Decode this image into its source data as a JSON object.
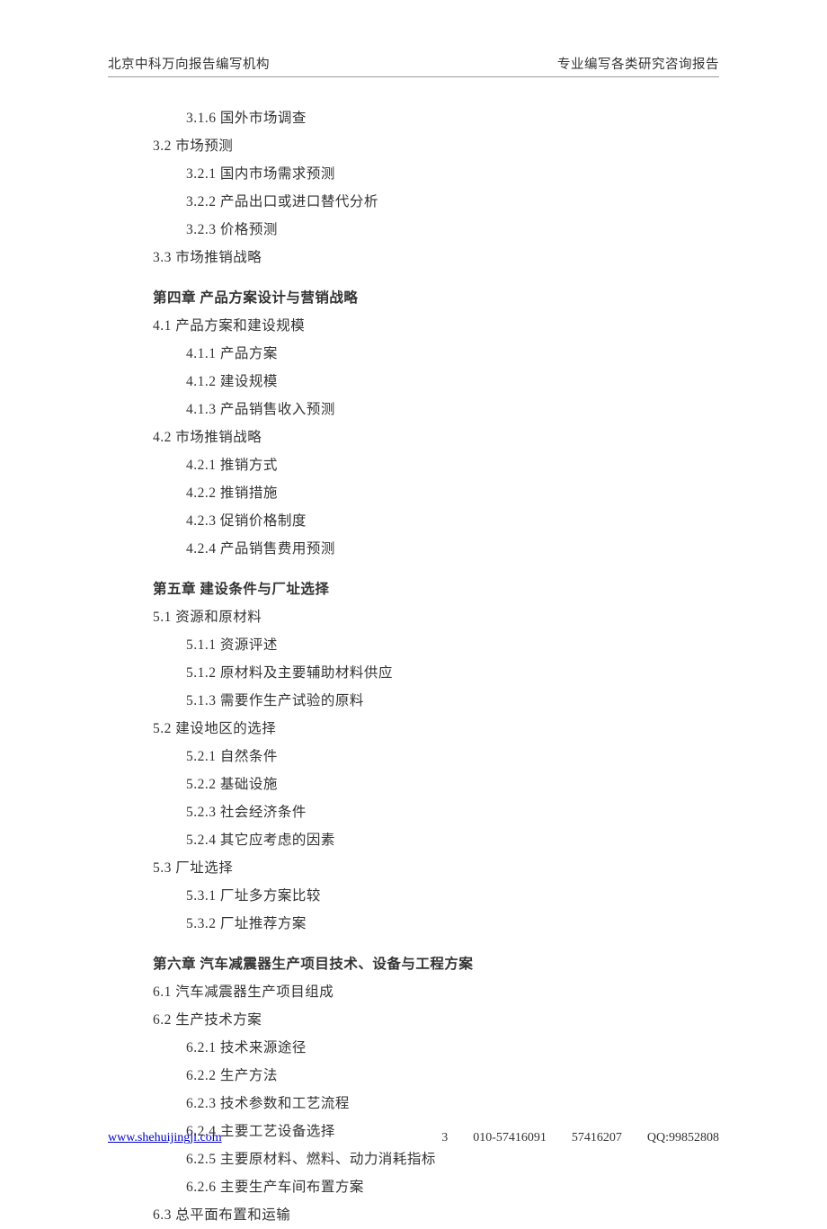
{
  "header": {
    "left": "北京中科万向报告编写机构",
    "right": "专业编写各类研究咨询报告"
  },
  "toc": {
    "cont316": "3.1.6 国外市场调查",
    "s32": "3.2 市场预测",
    "s321": "3.2.1 国内市场需求预测",
    "s322": "3.2.2 产品出口或进口替代分析",
    "s323": "3.2.3 价格预测",
    "s33": "3.3 市场推销战略",
    "ch4": "第四章 产品方案设计与营销战略",
    "s41": "4.1 产品方案和建设规模",
    "s411": "4.1.1 产品方案",
    "s412": "4.1.2 建设规模",
    "s413": "4.1.3 产品销售收入预测",
    "s42": "4.2 市场推销战略",
    "s421": "4.2.1 推销方式",
    "s422": "4.2.2 推销措施",
    "s423": "4.2.3 促销价格制度",
    "s424": "4.2.4 产品销售费用预测",
    "ch5": "第五章 建设条件与厂址选择",
    "s51": "5.1 资源和原材料",
    "s511": "5.1.1 资源评述",
    "s512": "5.1.2 原材料及主要辅助材料供应",
    "s513": "5.1.3 需要作生产试验的原料",
    "s52": "5.2 建设地区的选择",
    "s521": "5.2.1 自然条件",
    "s522": "5.2.2 基础设施",
    "s523": "5.2.3 社会经济条件",
    "s524": "5.2.4 其它应考虑的因素",
    "s53": "5.3 厂址选择",
    "s531": "5.3.1 厂址多方案比较",
    "s532": "5.3.2 厂址推荐方案",
    "ch6": "第六章 汽车减震器生产项目技术、设备与工程方案",
    "s61": "6.1 汽车减震器生产项目组成",
    "s62": "6.2 生产技术方案",
    "s621": "6.2.1 技术来源途径",
    "s622": "6.2.2 生产方法",
    "s623": "6.2.3 技术参数和工艺流程",
    "s624": "6.2.4 主要工艺设备选择",
    "s625": "6.2.5 主要原材料、燃料、动力消耗指标",
    "s626": "6.2.6 主要生产车间布置方案",
    "s63": "6.3 总平面布置和运输"
  },
  "footer": {
    "url": "www.shehuijingji.com",
    "page": "3",
    "phone1": "010-57416091",
    "phone2": "57416207",
    "qq": "QQ:99852808"
  }
}
